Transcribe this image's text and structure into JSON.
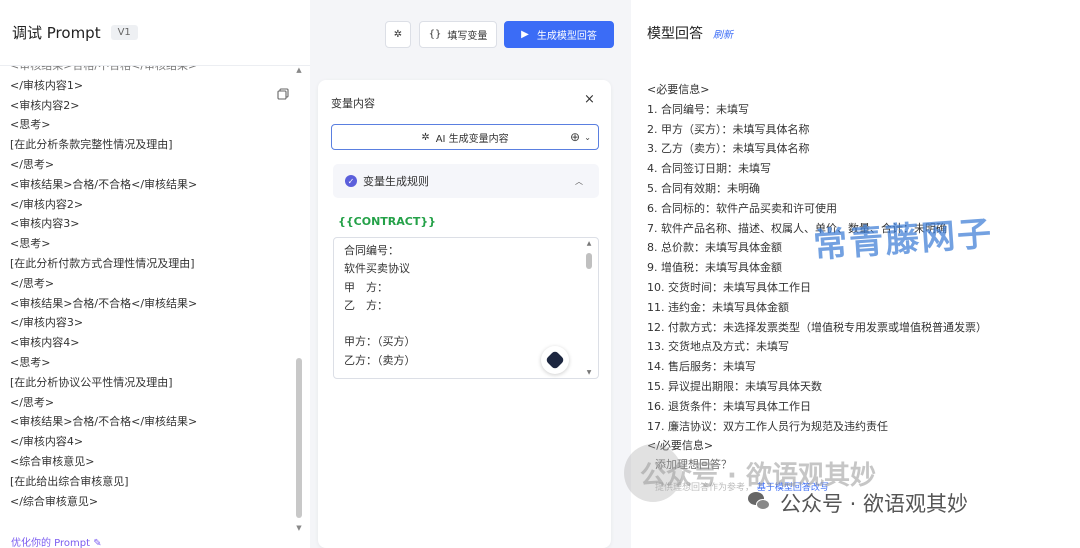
{
  "left": {
    "title": "调试 Prompt",
    "version": "V1",
    "prompt_lines": [
      "<审核结果>合格/不合格</审核结果>",
      "</审核内容1>",
      "<审核内容2>",
      "<思考>",
      "[在此分析条款完整性情况及理由]",
      "</思考>",
      "<审核结果>合格/不合格</审核结果>",
      "</审核内容2>",
      "<审核内容3>",
      "<思考>",
      "[在此分析付款方式合理性情况及理由]",
      "</思考>",
      "<审核结果>合格/不合格</审核结果>",
      "</审核内容3>",
      "<审核内容4>",
      "<思考>",
      "[在此分析协议公平性情况及理由]",
      "</思考>",
      "<审核结果>合格/不合格</审核结果>",
      "</审核内容4>",
      "<综合审核意见>",
      "[在此给出综合审核意见]",
      "</综合审核意见>"
    ],
    "optimize_label": "优化你的 Prompt",
    "optimize_glyph": "✎"
  },
  "toolbar": {
    "sparkle_glyph": "✲",
    "fill_icon": "{}",
    "fill_label": "填写变量",
    "generate_icon": "▶",
    "generate_label": "生成模型回答"
  },
  "variables_panel": {
    "title": "变量内容",
    "close_glyph": "×",
    "ai_sparkle": "✲",
    "ai_label": "AI 生成变量内容",
    "globe_glyph": "⊕",
    "chevron_glyph": "⌄",
    "rules_check": "✓",
    "rules_label": "变量生成规则",
    "rules_caret": "︿",
    "var_name": "{{CONTRACT}}",
    "var_lines": [
      "合同编号：",
      "软件买卖协议",
      "甲　方：",
      "乙　方：",
      "",
      "甲方：（买方）",
      "乙方：（卖方）"
    ],
    "scroll_up": "▲",
    "scroll_down": "▼"
  },
  "right": {
    "title": "模型回答",
    "refresh_label": "刷新",
    "response_lines": [
      "<必要信息>",
      "1. 合同编号：未填写",
      "2. 甲方（买方）：未填写具体名称",
      "3. 乙方（卖方）：未填写具体名称",
      "4. 合同签订日期：未填写",
      "5. 合同有效期：未明确",
      "6. 合同标的：软件产品买卖和许可使用",
      "7. 软件产品名称、描述、权属人、单价、数量、合计：未明确",
      "8. 总价款：未填写具体金额",
      "9. 增值税：未填写具体金额",
      "10. 交货时间：未填写具体工作日",
      "11. 违约金：未填写具体金额",
      "12. 付款方式：未选择发票类型（增值税专用发票或增值税普通发票）",
      "13. 交货地点及方式：未填写",
      "14. 售后服务：未填写",
      "15. 异议提出期限：未填写具体天数",
      "16. 退货条件：未填写具体工作日",
      "17. 廉洁协议：双方工作人员行为规范及违约责任",
      "</必要信息>"
    ],
    "add_ideal": "添加理想回答？",
    "hint_text": "提供理想回答作为参考，",
    "hint_link": "基于模型回答改写"
  },
  "watermarks": {
    "brand": "常青藤网子",
    "gray_text": "公众号 · 欲语观其妙",
    "official": "公众号 · 欲语观其妙"
  },
  "colors": {
    "accent": "#3b6cf6",
    "variable_green": "#24a148",
    "rules_check": "#5b5fdb",
    "watermark_blue": "#3e7ed6"
  }
}
